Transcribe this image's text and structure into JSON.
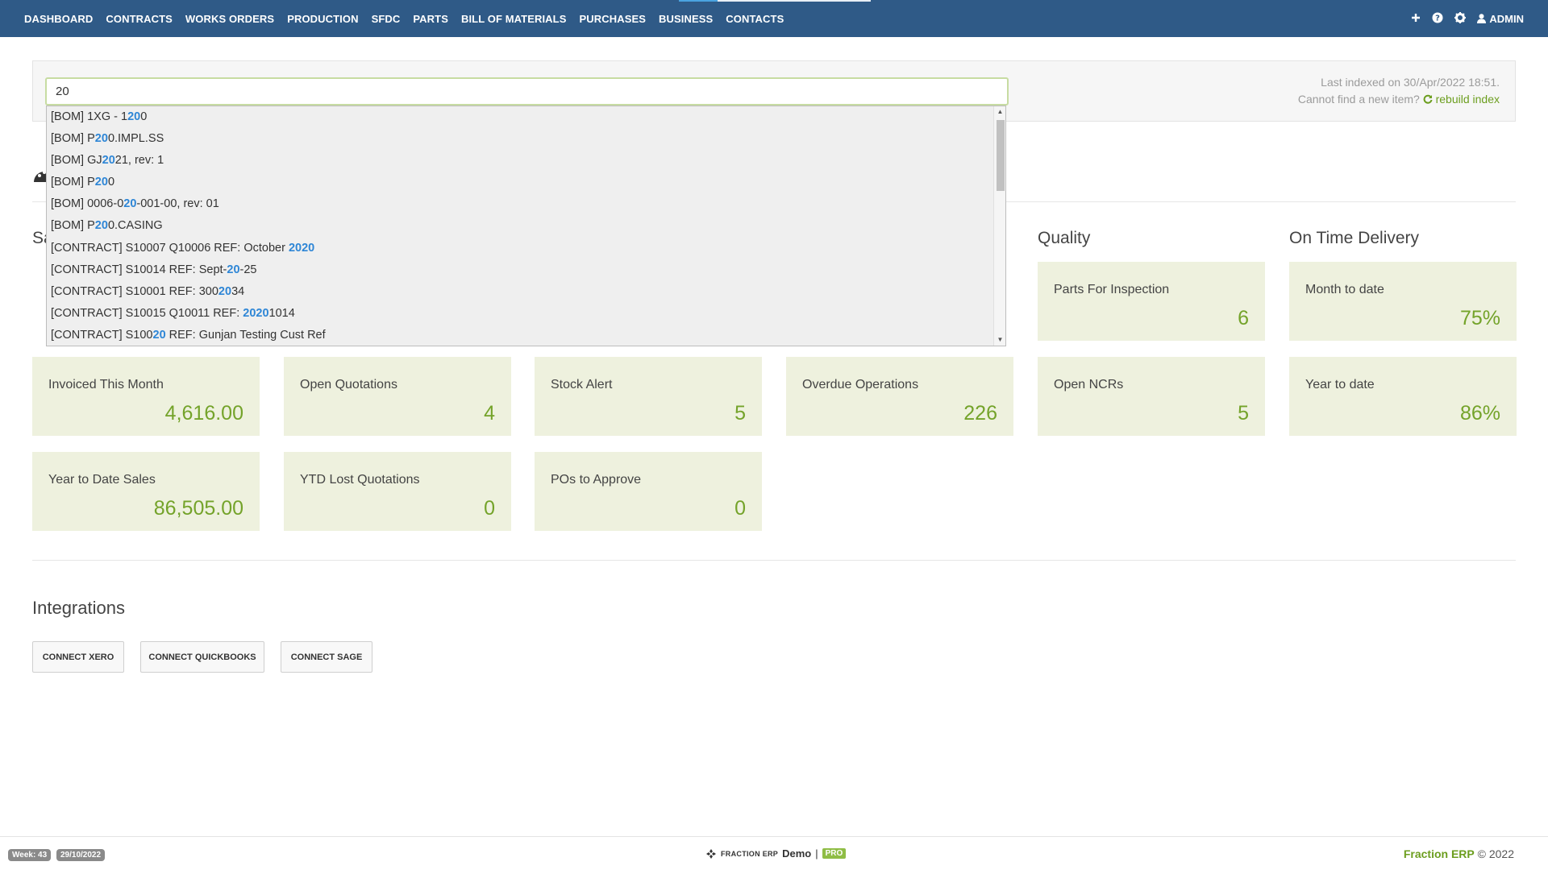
{
  "nav": {
    "items": [
      "DASHBOARD",
      "CONTRACTS",
      "WORKS ORDERS",
      "PRODUCTION",
      "SFDC",
      "PARTS",
      "BILL OF MATERIALS",
      "PURCHASES",
      "BUSINESS",
      "CONTACTS"
    ],
    "admin_label": "ADMIN",
    "icons": [
      "plus-icon",
      "help-icon",
      "gear-icon",
      "user-icon"
    ]
  },
  "search": {
    "value": "20",
    "last_indexed": "Last indexed on 30/Apr/2022 18:51.",
    "cannot_find": "Cannot find a new item?",
    "rebuild_label": "rebuild index"
  },
  "dropdown": {
    "items": [
      {
        "pre": "[BOM] 1XG - 1",
        "hl": "20",
        "post": "0"
      },
      {
        "pre": "[BOM] P",
        "hl": "20",
        "post": "0.IMPL.SS"
      },
      {
        "pre": "[BOM] GJ",
        "hl": "20",
        "post": "21, rev: 1"
      },
      {
        "pre": "[BOM] P",
        "hl": "20",
        "post": "0"
      },
      {
        "pre": "[BOM] 0006-0",
        "hl": "20",
        "post": "-001-00, rev: 01"
      },
      {
        "pre": "[BOM] P",
        "hl": "20",
        "post": "0.CASING"
      },
      {
        "pre": "[CONTRACT] S10007 Q10006 REF: October ",
        "hl": "2020",
        "post": ""
      },
      {
        "pre": "[CONTRACT] S10014 REF: Sept-",
        "hl": "20",
        "post": "-25"
      },
      {
        "pre": "[CONTRACT] S10001 REF: 300",
        "hl": "20",
        "post": "34"
      },
      {
        "pre": "[CONTRACT] S10015 Q10011 REF: ",
        "hl": "2020",
        "post": "1014"
      },
      {
        "pre": "[CONTRACT] S100",
        "hl": "20",
        "post": " REF: Gunjan Testing Cust Ref"
      }
    ]
  },
  "sections": {
    "sales_partial": "Sa",
    "quality": "Quality",
    "on_time": "On Time Delivery"
  },
  "cards": {
    "parts_inspection": {
      "label": "Parts For Inspection",
      "value": "6"
    },
    "month_to_date": {
      "label": "Month to date",
      "value": "75%"
    },
    "invoiced": {
      "label": "Invoiced This Month",
      "value": "4,616.00"
    },
    "open_quotations": {
      "label": "Open Quotations",
      "value": "4"
    },
    "stock_alert": {
      "label": "Stock Alert",
      "value": "5"
    },
    "overdue_ops": {
      "label": "Overdue Operations",
      "value": "226"
    },
    "open_ncrs": {
      "label": "Open NCRs",
      "value": "5"
    },
    "year_to_date": {
      "label": "Year to date",
      "value": "86%"
    },
    "ytd_sales": {
      "label": "Year to Date Sales",
      "value": "86,505.00"
    },
    "ytd_lost": {
      "label": "YTD Lost Quotations",
      "value": "0"
    },
    "pos_approve": {
      "label": "POs to Approve",
      "value": "0"
    }
  },
  "integrations": {
    "title": "Integrations",
    "buttons": [
      "CONNECT XERO",
      "CONNECT QUICKBOOKS",
      "CONNECT SAGE"
    ]
  },
  "footer": {
    "week": "Week: 43",
    "date": "29/10/2022",
    "brand_small": "FRACTION ERP",
    "demo": "Demo",
    "separator": "|",
    "pro": "PRO",
    "brand": "Fraction ERP",
    "copyright": "© 2022"
  },
  "colors": {
    "nav_bg": "#2f5a87",
    "card_bg": "#eef1de",
    "card_value": "#74a32a",
    "highlight": "#2e86d6",
    "brand_green": "#6c9e1f"
  }
}
